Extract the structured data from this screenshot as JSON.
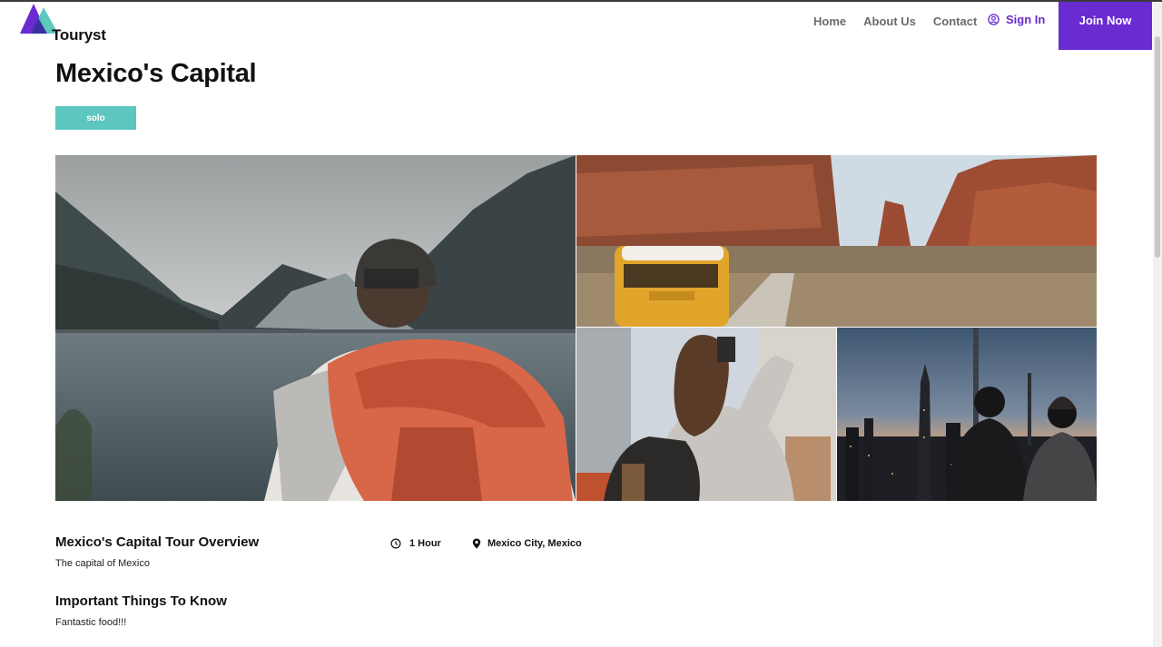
{
  "brand": {
    "name": "Touryst"
  },
  "nav": {
    "items": [
      "Home",
      "About Us",
      "Contact"
    ],
    "sign_in": "Sign In",
    "join_now": "Join Now"
  },
  "tour": {
    "title": "Mexico's Capital",
    "tag": "solo",
    "overview_title": "Mexico's Capital Tour Overview",
    "overview_desc": "The capital of Mexico",
    "duration": "1 Hour",
    "location": "Mexico City, Mexico",
    "things_title": "Important Things To Know",
    "things_desc": "Fantastic food!!!"
  },
  "gallery": {
    "images": [
      "hiker-by-lake-photo",
      "camper-van-desert-photo",
      "traveler-in-city-photo",
      "couple-city-skyline-photo"
    ]
  },
  "colors": {
    "accent": "#6a2bd1",
    "tag": "#5cc6bf"
  }
}
